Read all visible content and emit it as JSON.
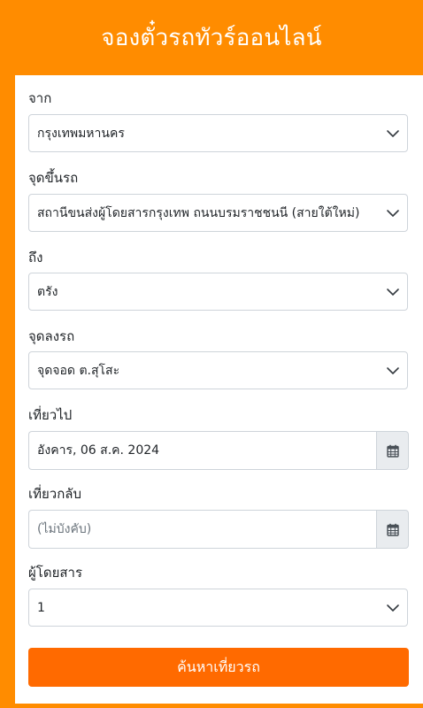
{
  "header": {
    "title": "จองตั๋วรถทัวร์ออนไลน์"
  },
  "form": {
    "from": {
      "label": "จาก",
      "value": "กรุงเทพมหานคร"
    },
    "pickup": {
      "label": "จุดขึ้นรถ",
      "value": "สถานีขนส่งผู้โดยสารกรุงเทพ ถนนบรมราชชนนี (สายใต้ใหม่)"
    },
    "to": {
      "label": "ถึง",
      "value": "ตรัง"
    },
    "dropoff": {
      "label": "จุดลงรถ",
      "value": "จุดจอด ต.สุโสะ"
    },
    "depart": {
      "label": "เที่ยวไป",
      "value": "อังคาร, 06 ส.ค. 2024"
    },
    "return": {
      "label": "เที่ยวกลับ",
      "placeholder": "(ไม่บังคับ)"
    },
    "passengers": {
      "label": "ผู้โดยสาร",
      "value": "1"
    },
    "submit_label": "ค้นหาเที่ยวรถ"
  },
  "colors": {
    "brand_orange": "#ff8c00",
    "button_orange": "#ff6a00"
  },
  "icons": {
    "dropdown": "chevron-down-icon",
    "calendar": "calendar-icon"
  }
}
